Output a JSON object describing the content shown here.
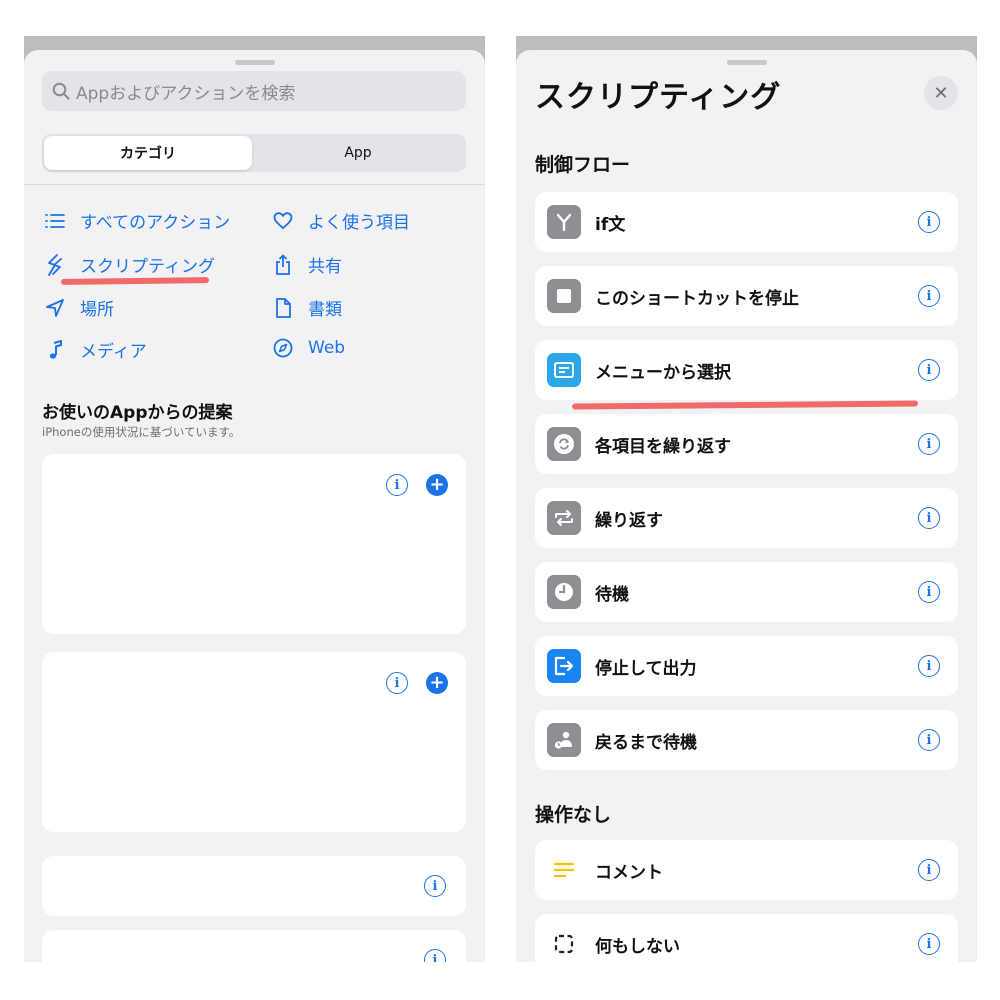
{
  "left": {
    "search_placeholder": "Appおよびアクションを検索",
    "segments": [
      "カテゴリ",
      "App"
    ],
    "categories": [
      {
        "label": "すべてのアクション",
        "icon": "list-icon"
      },
      {
        "label": "よく使う項目",
        "icon": "heart-icon"
      },
      {
        "label": "スクリプティング",
        "icon": "scripting-icon"
      },
      {
        "label": "共有",
        "icon": "share-icon"
      },
      {
        "label": "場所",
        "icon": "location-arrow-icon"
      },
      {
        "label": "書類",
        "icon": "document-icon"
      },
      {
        "label": "メディア",
        "icon": "music-note-icon"
      },
      {
        "label": "Web",
        "icon": "compass-icon"
      }
    ],
    "suggestions_title": "お使いのAppからの提案",
    "suggestions_subtitle": "iPhoneの使用状況に基づいています。"
  },
  "right": {
    "title": "スクリプティング",
    "close_label": "✕",
    "sections": [
      {
        "header": "制御フロー",
        "items": [
          {
            "label": "if文",
            "icon": "branch-icon",
            "color": "#8e8e93"
          },
          {
            "label": "このショートカットを停止",
            "icon": "stop-icon",
            "color": "#8e8e93"
          },
          {
            "label": "メニューから選択",
            "icon": "menu-icon",
            "color": "#2aa7e8"
          },
          {
            "label": "各項目を繰り返す",
            "icon": "repeat-each-icon",
            "color": "#8e8e93"
          },
          {
            "label": "繰り返す",
            "icon": "repeat-icon",
            "color": "#8e8e93"
          },
          {
            "label": "待機",
            "icon": "clock-icon",
            "color": "#8e8e93"
          },
          {
            "label": "停止して出力",
            "icon": "exit-icon",
            "color": "#1a84f0"
          },
          {
            "label": "戻るまで待機",
            "icon": "return-wait-icon",
            "color": "#8e8e93"
          }
        ]
      },
      {
        "header": "操作なし",
        "items": [
          {
            "label": "コメント",
            "icon": "comment-lines-icon",
            "color": "#f5c400"
          },
          {
            "label": "何もしない",
            "icon": "dashed-square-icon",
            "color": "#222222"
          }
        ]
      }
    ]
  },
  "colors": {
    "accent": "#1a73e8",
    "highlight": "#f06a6a"
  }
}
